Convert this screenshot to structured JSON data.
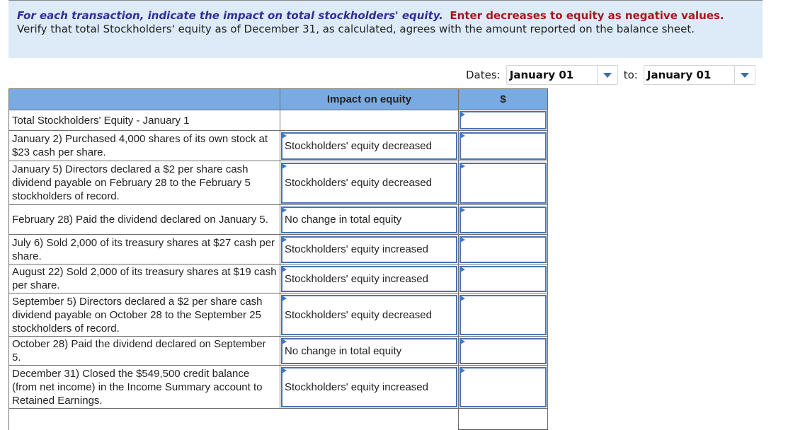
{
  "instructions": {
    "italic_blue": "For each transaction, indicate the impact on total stockholders' equity.",
    "bold_red": "Enter decreases to equity as negative values.",
    "plain": "Verify that total Stockholders' equity as of December 31, as calculated, agrees with the amount reported on the balance sheet."
  },
  "dates": {
    "label": "Dates:",
    "from_value": "January 01",
    "to_label": "to:",
    "to_value": "January 01"
  },
  "table": {
    "headers": [
      "",
      "Impact on equity",
      "$"
    ],
    "rows": [
      {
        "description": "Total Stockholders' Equity - January 1",
        "impact": "",
        "amount": ""
      },
      {
        "description": "January 2)  Purchased 4,000 shares of its own stock at $23 cash per share.",
        "impact": "Stockholders' equity decreased",
        "amount": ""
      },
      {
        "description": "January 5)  Directors declared a $2 per share cash dividend payable on February 28 to the February 5 stockholders of record.",
        "impact": "Stockholders' equity decreased",
        "amount": ""
      },
      {
        "description": "February 28)  Paid the dividend declared on January 5.",
        "impact": "No change in total equity",
        "amount": ""
      },
      {
        "description": "July 6)  Sold 2,000 of its treasury shares at $27 cash per share.",
        "impact": "Stockholders' equity increased",
        "amount": ""
      },
      {
        "description": "August 22)  Sold 2,000 of its treasury shares at $19 cash per share.",
        "impact": "Stockholders' equity increased",
        "amount": ""
      },
      {
        "description": "September 5)  Directors declared a $2 per share cash dividend payable on October 28 to the September 25 stockholders of record.",
        "impact": "Stockholders' equity decreased",
        "amount": ""
      },
      {
        "description": "October 28)  Paid the dividend declared on September 5.",
        "impact": "No change in total equity",
        "amount": ""
      },
      {
        "description": "December 31)  Closed the $549,500 credit balance (from net income) in the Income Summary account to Retained Earnings.",
        "impact": "Stockholders' equity increased",
        "amount": ""
      }
    ],
    "total_row": {
      "description": "",
      "amount": ""
    }
  }
}
